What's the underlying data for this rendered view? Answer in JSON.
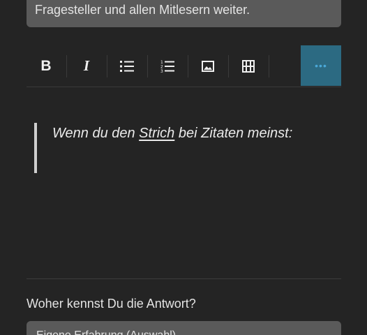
{
  "hint": {
    "text": "Fragesteller und allen Mitlesern weiter."
  },
  "toolbar": {
    "bold_label": "B",
    "italic_label": "I",
    "more_label": "•••",
    "icons": [
      "bold-icon",
      "italic-icon",
      "bullet-list-icon",
      "numbered-list-icon",
      "image-icon",
      "video-icon",
      "more-icon"
    ],
    "accent_color": "#2c6a82",
    "more_dots_color": "#4aa8d8"
  },
  "editor": {
    "quote": {
      "before": "Wenn du den ",
      "link": "Strich",
      "after": " bei Zitaten meinst:"
    }
  },
  "source": {
    "question": "Woher kennst Du die Antwort?",
    "select_value": "Eigene Erfahrung (Auswahl)"
  }
}
